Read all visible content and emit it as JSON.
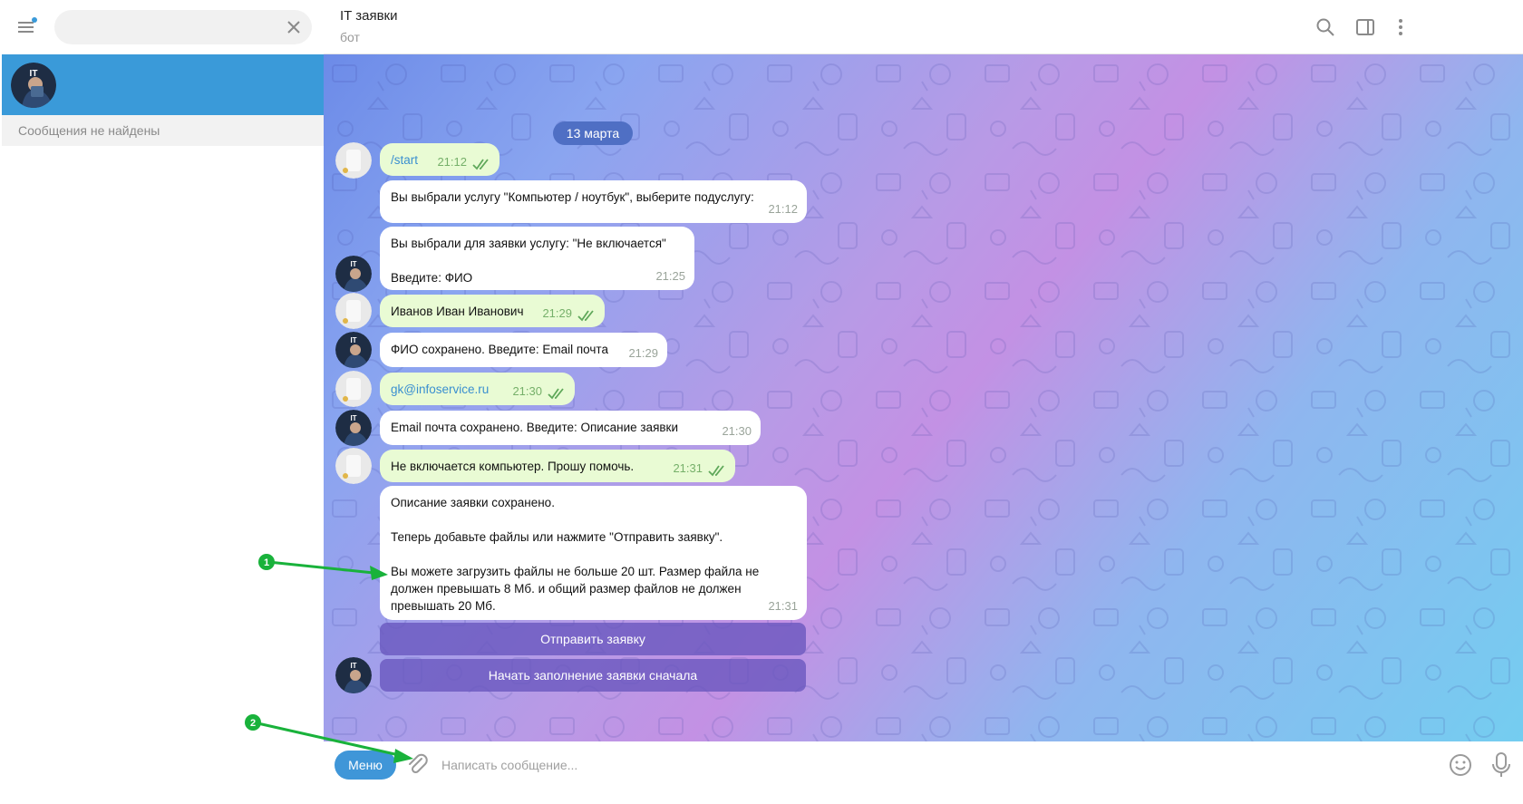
{
  "sidebar": {
    "search": {
      "value": "",
      "placeholder": ""
    },
    "avatar_initials": "IT",
    "no_results": "Сообщения не найдены"
  },
  "header": {
    "title": "IT заявки",
    "subtitle": "бот"
  },
  "chat": {
    "date": "13 марта",
    "messages": [
      {
        "dir": "out",
        "lines": [
          "/start"
        ],
        "time": "21:12"
      },
      {
        "dir": "in",
        "lines": [
          "Вы выбрали услугу \"Компьютер / ноутбук\", выберите подуслугу:"
        ],
        "time": "21:12"
      },
      {
        "dir": "in",
        "lines": [
          "Вы выбрали для заявки услугу: \"Не включается\"",
          "",
          "Введите: ФИО"
        ],
        "time": "21:25"
      },
      {
        "dir": "out",
        "lines": [
          "Иванов Иван Иванович"
        ],
        "time": "21:29"
      },
      {
        "dir": "in",
        "lines": [
          "ФИО  сохранено. Введите:  Email почта"
        ],
        "time": "21:29"
      },
      {
        "dir": "out",
        "lines": [
          "gk@infoservice.ru"
        ],
        "time": "21:30"
      },
      {
        "dir": "in",
        "lines": [
          "Email почта  сохранено. Введите:  Описание заявки"
        ],
        "time": "21:30"
      },
      {
        "dir": "out",
        "lines": [
          "Не включается компьютер. Прошу помочь."
        ],
        "time": "21:31"
      },
      {
        "dir": "in",
        "lines": [
          "Описание заявки  сохранено.",
          "",
          "Теперь добавьте файлы или нажмите \"Отправить заявку\".",
          "",
          "Вы можете загрузить файлы не больше 20 шт. Размер файла не",
          "должен превышать 8 Мб. и общий размер файлов не должен",
          "превышать 20 Мб."
        ],
        "time": "21:31"
      }
    ],
    "keyboard": [
      "Отправить заявку",
      "Начать заполнение заявки сначала"
    ]
  },
  "input": {
    "menu_label": "Меню",
    "placeholder": "Написать сообщение..."
  },
  "annotations": [
    "1",
    "2"
  ],
  "colors": {
    "accent": "#3a9ad9",
    "outgoing_bubble": "#e9fbd4",
    "keyboard_button": "#6856be",
    "annotation_arrow": "#19b23b"
  }
}
